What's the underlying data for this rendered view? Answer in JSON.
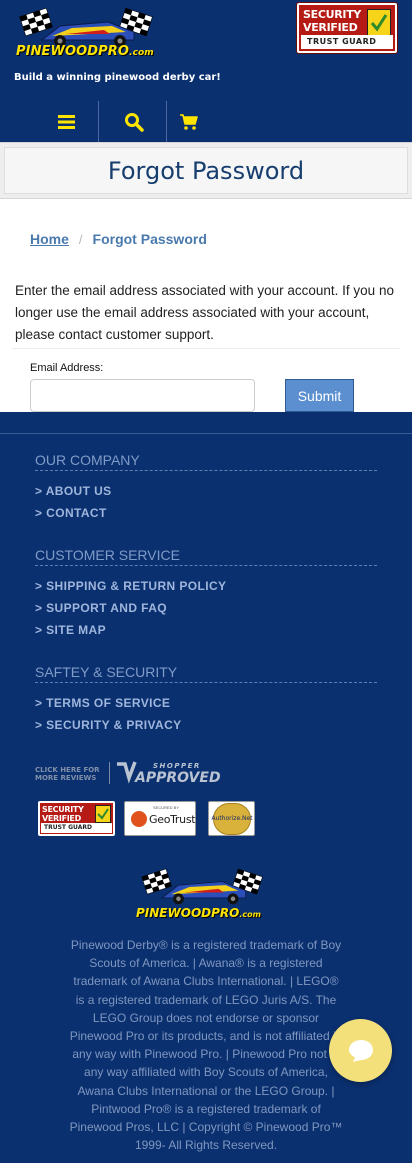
{
  "header": {
    "logo": {
      "name": "PINEWOODPRO",
      "suffix": ".com"
    },
    "tagline": "Build a winning pinewood derby car!",
    "trust_badge": {
      "line1": "SECURITY",
      "line2": "VERIFIED",
      "bottom": "TRUST GUARD"
    },
    "nav": [
      {
        "icon": "menu-icon"
      },
      {
        "icon": "search-icon"
      },
      {
        "icon": "cart-icon"
      }
    ],
    "colors": {
      "background": "#0b3070",
      "accent": "#ffe400"
    }
  },
  "page": {
    "title": "Forgot Password",
    "breadcrumb": {
      "home": "Home",
      "separator": "/",
      "current": "Forgot Password"
    },
    "instructions": "Enter the email address associated with your account. If you no longer use the email address associated with your account, please contact customer support.",
    "form": {
      "email_label": "Email Address:",
      "email_value": "",
      "submit_label": "Submit"
    }
  },
  "footer": {
    "sections": [
      {
        "heading": "OUR COMPANY",
        "links": [
          "> ABOUT US",
          "> CONTACT"
        ]
      },
      {
        "heading": "CUSTOMER SERVICE",
        "links": [
          "> SHIPPING & RETURN POLICY",
          "> SUPPORT AND FAQ",
          "> SITE MAP"
        ]
      },
      {
        "heading": "SAFTEY & SECURITY",
        "links": [
          "> TERMS OF SERVICE",
          "> SECURITY & PRIVACY"
        ]
      }
    ],
    "shopper_approved": {
      "small_line1": "CLICK HERE FOR",
      "small_line2": "MORE REVIEWS",
      "shopper": "SHOPPER",
      "approved": "APPROVED"
    },
    "badges": {
      "trust": {
        "line1": "SECURITY",
        "line2": "VERIFIED",
        "bottom": "TRUST GUARD"
      },
      "geotrust": {
        "small": "SECURED BY",
        "name": "GeoTrust"
      },
      "authorize": {
        "name": "Authorize.Net"
      }
    },
    "logo": {
      "name": "PINEWOODPRO",
      "suffix": ".com"
    },
    "legal": "Pinewood Derby® is a registered trademark of Boy Scouts of America. | Awana® is a registered trademark of Awana Clubs International. | LEGO® is a registered trademark of LEGO Juris A/S. The LEGO Group does not endorse or sponsor Pinewood Pro or its products, and is not affiliated in any way with Pinewood Pro. | Pinewood Pro not in any way affiliated with Boy Scouts of America, Awana Clubs International or the LEGO Group. | Pintwood Pro® is a registered trademark of Pinewood Pros, LLC | Copyright © Pinewood Pro™ 1999- All Rights Reserved.",
    "chat_icon": "chat-bubble-icon"
  }
}
